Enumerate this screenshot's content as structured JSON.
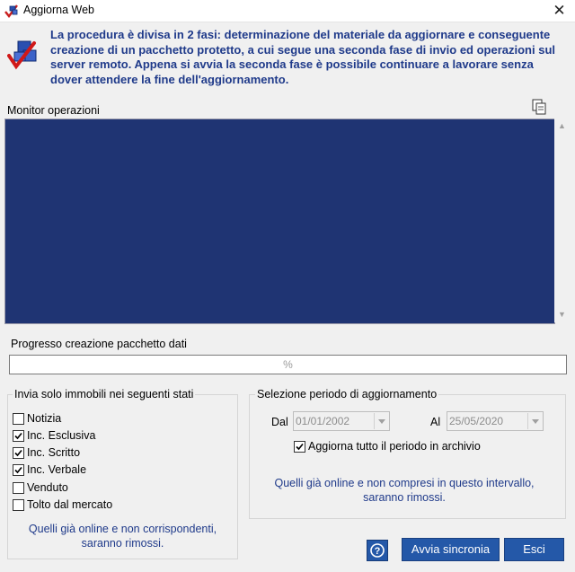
{
  "window": {
    "title": "Aggiorna Web",
    "close_glyph": "✕"
  },
  "intro": {
    "text": "La procedura è divisa in 2 fasi: determinazione del materiale da aggiornare e conseguente creazione di un pacchetto protetto, a cui segue una seconda fase di invio ed operazioni sul server remoto. Appena si avvia la seconda fase è possibile continuare a lavorare senza dover attendere la fine dell'aggiornamento.",
    "icon": "checklist-icon"
  },
  "monitor": {
    "label": "Monitor operazioni",
    "copy_icon": "copy-icon",
    "bg": "#1f3473"
  },
  "progress": {
    "label": "Progresso creazione pacchetto dati",
    "text": "%",
    "value": 0
  },
  "states_group": {
    "title": "Invia solo immobili nei seguenti stati",
    "items": [
      {
        "label": "Notizia",
        "checked": false
      },
      {
        "label": "Inc. Esclusiva",
        "checked": true
      },
      {
        "label": "Inc. Scritto",
        "checked": true
      },
      {
        "label": "Inc. Verbale",
        "checked": true
      },
      {
        "label": "Venduto",
        "checked": false
      },
      {
        "label": "Tolto dal mercato",
        "checked": false
      }
    ],
    "note": "Quelli già online e non corrispondenti, saranno rimossi."
  },
  "period_group": {
    "title": "Selezione periodo di aggiornamento",
    "from_label": "Dal",
    "from_value": "01/01/2002",
    "to_label": "Al",
    "to_value": "25/05/2020",
    "all_period_label": "Aggiorna tutto il periodo in archivio",
    "all_period_checked": true,
    "note": "Quelli già online e non compresi in questo intervallo, saranno rimossi."
  },
  "buttons": {
    "help_icon": "help-icon",
    "sync": "Avvia sincronia",
    "exit": "Esci"
  },
  "colors": {
    "accent_text": "#1f3a8a",
    "button": "#2458a8"
  }
}
